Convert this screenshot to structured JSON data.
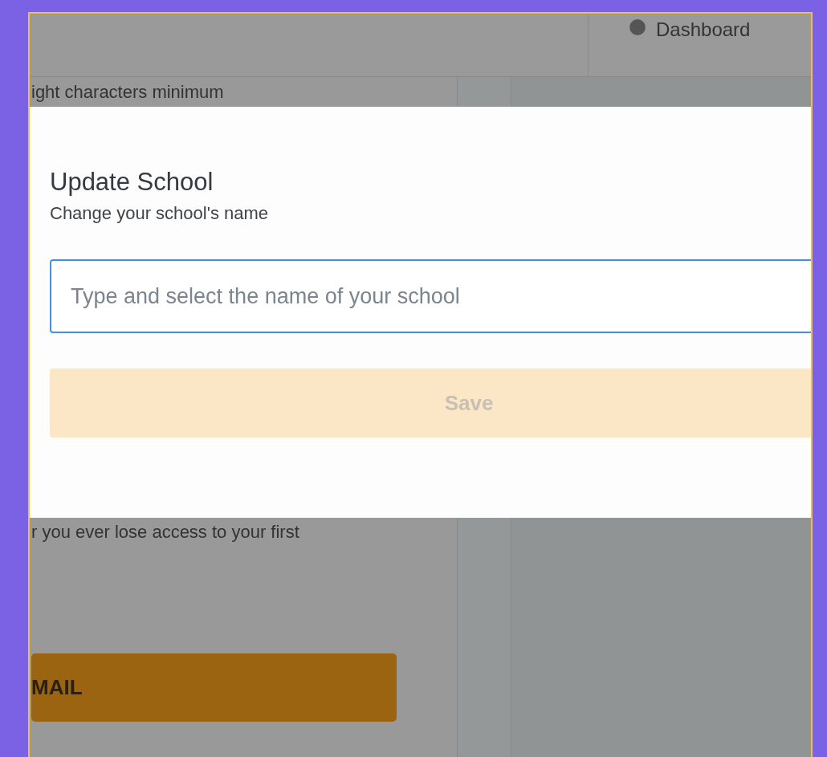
{
  "header": {
    "nav_link": "Dashboard"
  },
  "background_page": {
    "hint": "ight characters minimum",
    "note": "r you ever lose access to your first",
    "button": "MAIL"
  },
  "dialog": {
    "title": "Update School",
    "subtitle": "Change your school's name",
    "school_field": {
      "placeholder": "Type and select the name of your school"
    },
    "save_button": {
      "label": "Save",
      "disabled": true
    }
  }
}
